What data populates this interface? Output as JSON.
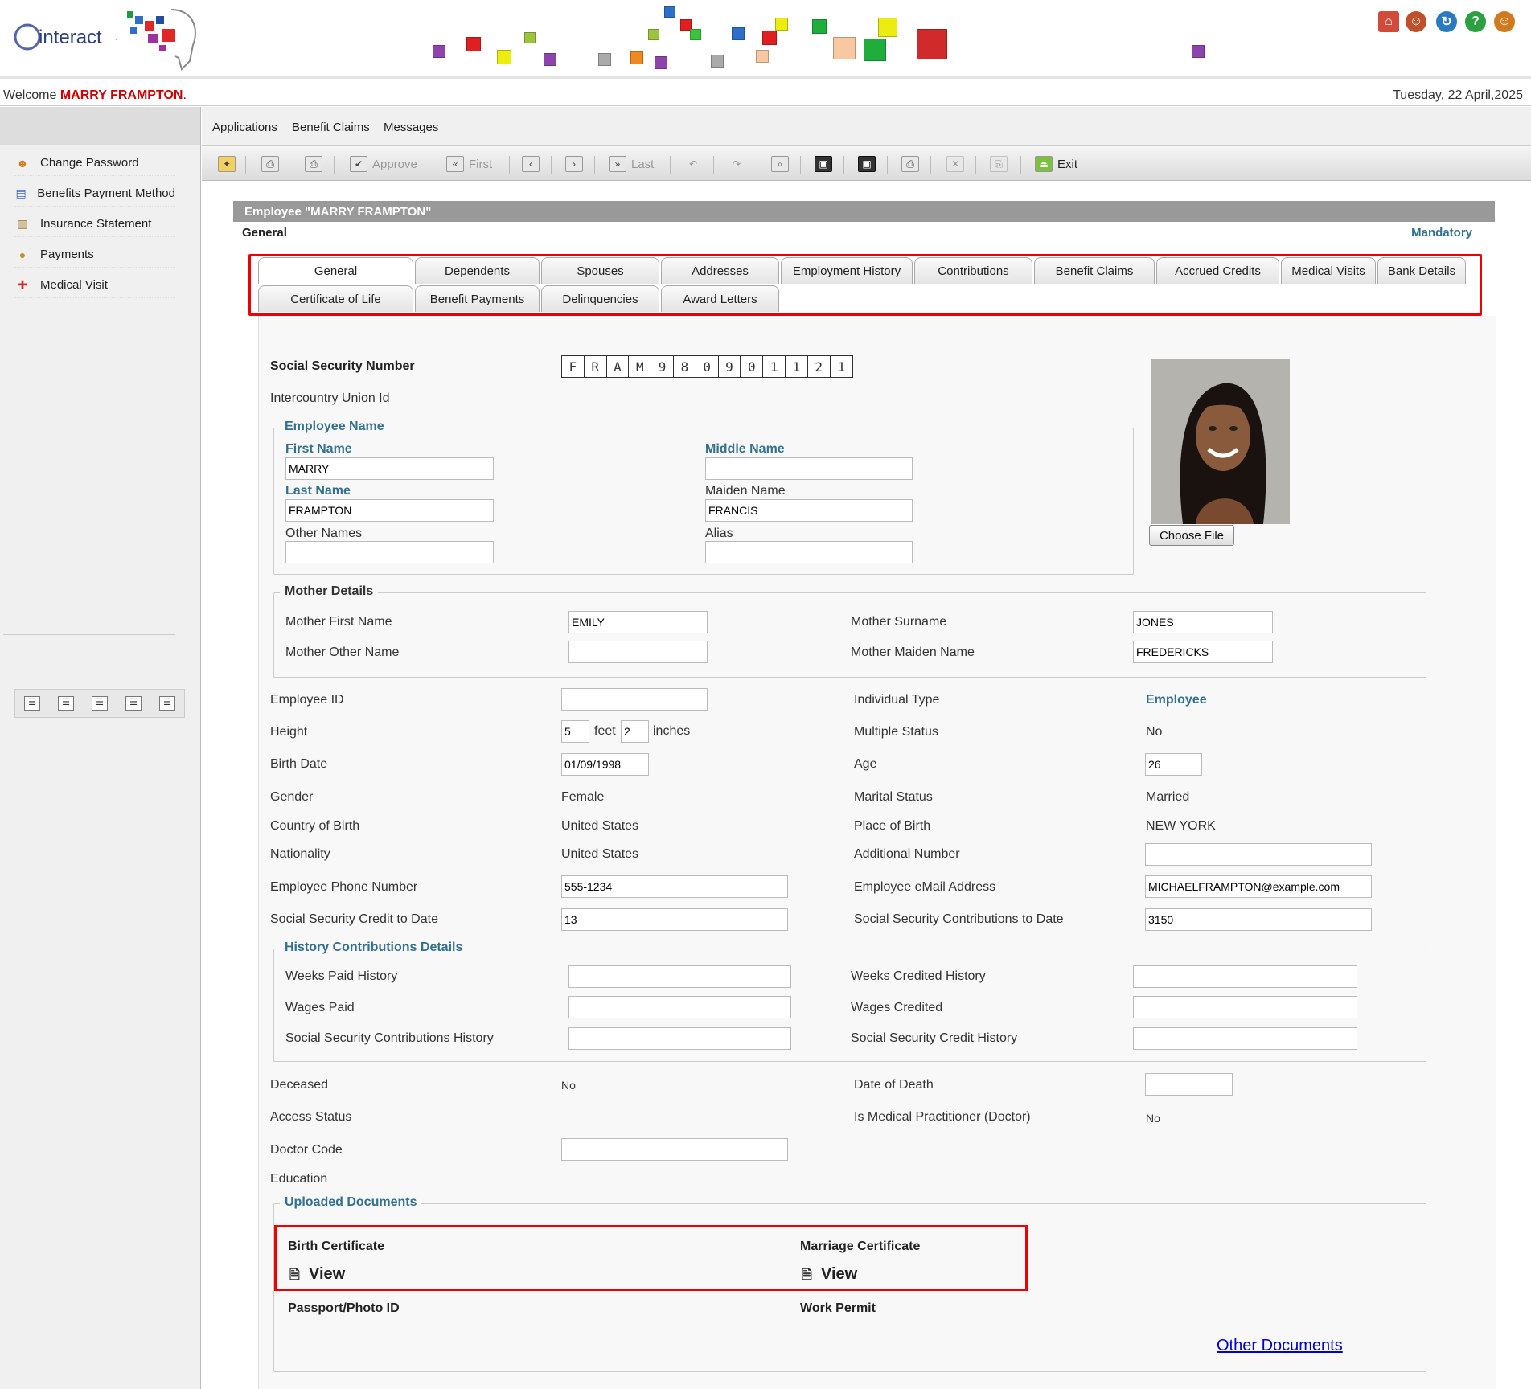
{
  "header": {
    "logo_text": "interact",
    "user_icons": [
      "home-icon",
      "user-icon",
      "refresh-icon",
      "help-icon",
      "logout-icon"
    ]
  },
  "welcome": {
    "prefix": "Welcome",
    "name": "MARRY FRAMPTON",
    "suffix": ".",
    "date": "Tuesday, 22 April,2025"
  },
  "sidebar": {
    "items": [
      {
        "label": "Change Password",
        "icon": "key-user-icon"
      },
      {
        "label": "Benefits Payment Method",
        "icon": "form-icon"
      },
      {
        "label": "Insurance Statement",
        "icon": "document-icon"
      },
      {
        "label": "Payments",
        "icon": "money-bag-icon"
      },
      {
        "label": "Medical Visit",
        "icon": "medical-icon"
      }
    ]
  },
  "menu": {
    "items": [
      "Applications",
      "Benefit Claims",
      "Messages"
    ]
  },
  "toolbar": {
    "approve": "Approve",
    "first": "First",
    "last": "Last",
    "exit": "Exit"
  },
  "record": {
    "title": "Employee \"MARRY FRAMPTON\"",
    "section": "General",
    "mandatory": "Mandatory"
  },
  "tabs": {
    "row1": [
      "General",
      "Dependents",
      "Spouses",
      "Addresses",
      "Employment History",
      "Contributions",
      "Benefit Claims",
      "Accrued Credits",
      "Medical Visits",
      "Bank Details"
    ],
    "row2": [
      "Certificate of Life",
      "Benefit Payments",
      "Delinquencies",
      "Award Letters"
    ]
  },
  "general": {
    "ssn_label": "Social Security Number",
    "ssn": [
      "F",
      "R",
      "A",
      "M",
      "9",
      "8",
      "0",
      "9",
      "0",
      "1",
      "1",
      "2",
      "1"
    ],
    "union_label": "Intercountry Union Id",
    "choose_file": "Choose File",
    "employee_name": {
      "legend": "Employee Name",
      "first_label": "First Name",
      "first": "MARRY",
      "middle_label": "Middle Name",
      "middle": "",
      "last_label": "Last Name",
      "last": "FRAMPTON",
      "maiden_label": "Maiden Name",
      "maiden": "FRANCIS",
      "other_label": "Other Names",
      "other": "",
      "alias_label": "Alias",
      "alias": ""
    },
    "mother": {
      "legend": "Mother Details",
      "first_label": "Mother First Name",
      "first": "EMILY",
      "surname_label": "Mother Surname",
      "surname": "JONES",
      "other_label": "Mother Other Name",
      "other": "",
      "maiden_label": "Mother Maiden Name",
      "maiden": "FREDERICKS"
    },
    "employee_id_label": "Employee ID",
    "employee_id": "",
    "individual_type_label": "Individual Type",
    "individual_type": "Employee",
    "height_label": "Height",
    "height_feet": "5",
    "feet": "feet",
    "height_inches": "2",
    "inches": "inches",
    "multiple_status_label": "Multiple Status",
    "multiple_status": "No",
    "birth_date_label": "Birth Date",
    "birth_date": "01/09/1998",
    "age_label": "Age",
    "age": "26",
    "gender_label": "Gender",
    "gender": "Female",
    "marital_label": "Marital Status",
    "marital": "Married",
    "country_birth_label": "Country of Birth",
    "country_birth": "United States",
    "place_birth_label": "Place of Birth",
    "place_birth": "NEW YORK",
    "nationality_label": "Nationality",
    "nationality": "United States",
    "additional_label": "Additional Number",
    "additional": "",
    "phone_label": "Employee Phone Number",
    "phone": "555-1234",
    "email_label": "Employee eMail Address",
    "email": "MICHAELFRAMPTON@example.com",
    "credit_label": "Social Security Credit to Date",
    "credit": "13",
    "contrib_label": "Social Security Contributions to Date",
    "contrib": "3150",
    "history": {
      "legend": "History Contributions Details",
      "weeks_paid_label": "Weeks Paid History",
      "weeks_credited_label": "Weeks Credited History",
      "wages_paid_label": "Wages Paid",
      "wages_credited_label": "Wages Credited",
      "ss_contrib_hist_label": "Social Security Contributions History",
      "ss_credit_hist_label": "Social Security Credit History"
    },
    "deceased_label": "Deceased",
    "deceased": "No",
    "date_death_label": "Date of Death",
    "access_label": "Access Status",
    "doctor_label": "Is Medical Practitioner (Doctor)",
    "doctor": "No",
    "doctor_code_label": "Doctor Code",
    "education_label": "Education",
    "uploads": {
      "legend": "Uploaded Documents",
      "birth": "Birth Certificate",
      "marriage": "Marriage Certificate",
      "view": "View",
      "passport": "Passport/Photo ID",
      "work_permit": "Work Permit",
      "other_docs": "Other Documents"
    }
  },
  "colors": {
    "accent_blue": "#33708f",
    "welcome_red": "#cc0000",
    "highlight_red": "#ee0000",
    "title_grey": "#999999"
  }
}
